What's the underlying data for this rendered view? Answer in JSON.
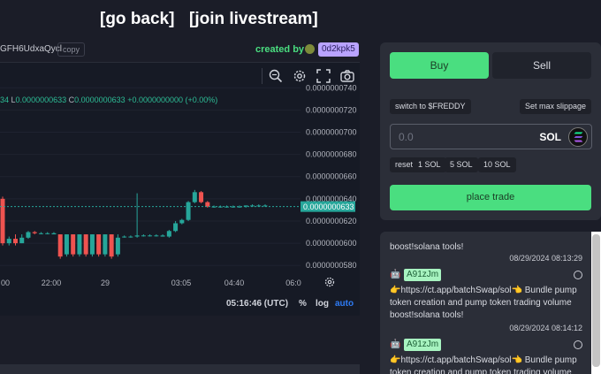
{
  "nav": {
    "back_label": "[go back]",
    "livestream_label": "[join livestream]"
  },
  "token": {
    "mint_suffix": "GFH6UdxaQycl",
    "copy_label": "copy",
    "created_by_label": "created by",
    "creator": "0d2kpk5"
  },
  "chart_data": {
    "type": "candlestick",
    "ohlc_line": {
      "prefix": "34",
      "low_label": "L",
      "low": "0.0000000633",
      "close_label": "C",
      "close": "0.0000000633",
      "change": "+0.0000000000 (+0.00%)"
    },
    "y_ticks": [
      "0.0000000740",
      "0.0000000720",
      "0.0000000700",
      "0.0000000680",
      "0.0000000660",
      "0.0000000640",
      "0.0000000620",
      "0.0000000600",
      "0.0000000580"
    ],
    "x_ticks": [
      "00",
      "22:00",
      "29",
      "03:05",
      "04:40",
      "06:0"
    ],
    "last_price": "0.0000000633",
    "candles": [
      {
        "o": 6.4e-08,
        "h": 6.42e-08,
        "c": 6e-08,
        "l": 5.98e-08,
        "dir": "down"
      },
      {
        "o": 6e-08,
        "h": 6.06e-08,
        "c": 6.04e-08,
        "l": 5.98e-08,
        "dir": "up"
      },
      {
        "o": 6.04e-08,
        "h": 6.08e-08,
        "c": 6e-08,
        "l": 5.98e-08,
        "dir": "down"
      },
      {
        "o": 6e-08,
        "h": 6.08e-08,
        "c": 6.05e-08,
        "l": 6e-08,
        "dir": "up"
      },
      {
        "o": 6.05e-08,
        "h": 6.11e-08,
        "c": 6.1e-08,
        "l": 6.04e-08,
        "dir": "up"
      },
      {
        "o": 6.1e-08,
        "h": 6.11e-08,
        "c": 6.09e-08,
        "l": 6.08e-08,
        "dir": "down"
      },
      {
        "o": 6.09e-08,
        "h": 6.1e-08,
        "c": 6.09e-08,
        "l": 6.08e-08,
        "dir": "flat"
      },
      {
        "o": 6.09e-08,
        "h": 6.1e-08,
        "c": 6.09e-08,
        "l": 6.08e-08,
        "dir": "flat"
      },
      {
        "o": 6.09e-08,
        "h": 6.1e-08,
        "c": 6.08e-08,
        "l": 6.08e-08,
        "dir": "flat"
      },
      {
        "o": 6.08e-08,
        "h": 6.08e-08,
        "c": 5.88e-08,
        "l": 5.86e-08,
        "dir": "down"
      },
      {
        "o": 6.08e-08,
        "h": 6.08e-08,
        "c": 5.9e-08,
        "l": 5.88e-08,
        "dir": "up"
      },
      {
        "o": 6.08e-08,
        "h": 6.08e-08,
        "c": 5.9e-08,
        "l": 5.88e-08,
        "dir": "down"
      },
      {
        "o": 6.08e-08,
        "h": 6.08e-08,
        "c": 5.9e-08,
        "l": 5.88e-08,
        "dir": "up"
      },
      {
        "o": 6.08e-08,
        "h": 6.08e-08,
        "c": 5.9e-08,
        "l": 5.88e-08,
        "dir": "down"
      },
      {
        "o": 6.08e-08,
        "h": 6.08e-08,
        "c": 5.9e-08,
        "l": 5.88e-08,
        "dir": "up"
      },
      {
        "o": 6.08e-08,
        "h": 6.08e-08,
        "c": 5.9e-08,
        "l": 5.88e-08,
        "dir": "down"
      },
      {
        "o": 6.08e-08,
        "h": 6.08e-08,
        "c": 5.9e-08,
        "l": 5.88e-08,
        "dir": "up"
      },
      {
        "o": 6.08e-08,
        "h": 6.08e-08,
        "c": 5.88e-08,
        "l": 5.86e-08,
        "dir": "down"
      },
      {
        "o": 5.9e-08,
        "h": 6.08e-08,
        "c": 6.05e-08,
        "l": 5.88e-08,
        "dir": "up"
      },
      {
        "o": 6.06e-08,
        "h": 6.07e-08,
        "c": 6.06e-08,
        "l": 6.05e-08,
        "dir": "flat"
      },
      {
        "o": 6.06e-08,
        "h": 6.07e-08,
        "c": 6.06e-08,
        "l": 6.05e-08,
        "dir": "flat"
      },
      {
        "o": 6.06e-08,
        "h": 6.45e-08,
        "c": 6.07e-08,
        "l": 6.05e-08,
        "dir": "up"
      },
      {
        "o": 6.07e-08,
        "h": 6.08e-08,
        "c": 6.07e-08,
        "l": 6.06e-08,
        "dir": "flat"
      },
      {
        "o": 6.07e-08,
        "h": 6.08e-08,
        "c": 6.07e-08,
        "l": 6.06e-08,
        "dir": "flat"
      },
      {
        "o": 6.07e-08,
        "h": 6.08e-08,
        "c": 6.07e-08,
        "l": 6.06e-08,
        "dir": "flat"
      },
      {
        "o": 6.07e-08,
        "h": 6.08e-08,
        "c": 6.06e-08,
        "l": 6.06e-08,
        "dir": "flat"
      },
      {
        "o": 6.06e-08,
        "h": 6.12e-08,
        "c": 6.11e-08,
        "l": 6.05e-08,
        "dir": "up"
      },
      {
        "o": 6.11e-08,
        "h": 6.2e-08,
        "c": 6.18e-08,
        "l": 6.1e-08,
        "dir": "up"
      },
      {
        "o": 6.18e-08,
        "h": 6.22e-08,
        "c": 6.21e-08,
        "l": 6.17e-08,
        "dir": "up"
      },
      {
        "o": 6.21e-08,
        "h": 6.38e-08,
        "c": 6.37e-08,
        "l": 6.2e-08,
        "dir": "up"
      },
      {
        "o": 6.37e-08,
        "h": 6.48e-08,
        "c": 6.46e-08,
        "l": 6.36e-08,
        "dir": "up"
      },
      {
        "o": 6.46e-08,
        "h": 6.47e-08,
        "c": 6.37e-08,
        "l": 6.36e-08,
        "dir": "down"
      },
      {
        "o": 6.37e-08,
        "h": 6.38e-08,
        "c": 6.33e-08,
        "l": 6.32e-08,
        "dir": "down"
      },
      {
        "o": 6.33e-08,
        "h": 6.34e-08,
        "c": 6.33e-08,
        "l": 6.32e-08,
        "dir": "flat"
      },
      {
        "o": 6.33e-08,
        "h": 6.34e-08,
        "c": 6.33e-08,
        "l": 6.32e-08,
        "dir": "flat"
      },
      {
        "o": 6.33e-08,
        "h": 6.34e-08,
        "c": 6.33e-08,
        "l": 6.32e-08,
        "dir": "flat"
      },
      {
        "o": 6.33e-08,
        "h": 6.34e-08,
        "c": 6.33e-08,
        "l": 6.32e-08,
        "dir": "flat"
      },
      {
        "o": 6.33e-08,
        "h": 6.34e-08,
        "c": 6.33e-08,
        "l": 6.32e-08,
        "dir": "flat"
      },
      {
        "o": 6.33e-08,
        "h": 6.34e-08,
        "c": 6.34e-08,
        "l": 6.32e-08,
        "dir": "flat"
      },
      {
        "o": 6.34e-08,
        "h": 6.35e-08,
        "c": 6.34e-08,
        "l": 6.33e-08,
        "dir": "flat"
      },
      {
        "o": 6.34e-08,
        "h": 6.35e-08,
        "c": 6.34e-08,
        "l": 6.33e-08,
        "dir": "flat"
      },
      {
        "o": 6.34e-08,
        "h": 6.35e-08,
        "c": 6.34e-08,
        "l": 6.33e-08,
        "dir": "flat"
      }
    ],
    "ylim": [
      5.73e-08,
      7.45e-08
    ],
    "colors": {
      "up": "#26a69a",
      "down": "#ef5350",
      "price_tag": "#26a69a"
    }
  },
  "chart_footer": {
    "time": "05:16:46 (UTC)",
    "percent_label": "%",
    "log_label": "log",
    "auto_label": "auto"
  },
  "trade": {
    "buy_label": "Buy",
    "sell_label": "Sell",
    "switch_label": "switch to $FREDDY",
    "slippage_label": "Set max slippage",
    "amount_placeholder": "0.0",
    "currency": "SOL",
    "presets": [
      "reset",
      "1 SOL",
      "5 SOL",
      "10 SOL"
    ],
    "place_label": "place trade"
  },
  "comments": [
    {
      "user": "",
      "text": "boost!solana tools!",
      "time": "08/29/2024 08:13:29"
    },
    {
      "user": "A91zJm",
      "text": "👉https://ct.app/batchSwap/sol👈 Bundle pump token creation and pump token trading volume boost!solana tools!",
      "time": "08/29/2024 08:14:12"
    },
    {
      "user": "A91zJm",
      "text": "👉https://ct.app/batchSwap/sol👈 Bundle pump token creation and pump token trading volume",
      "time": ""
    }
  ]
}
